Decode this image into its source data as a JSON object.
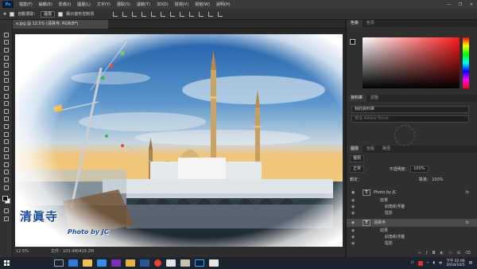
{
  "menubar": {
    "app_logo": "Ps",
    "items": [
      "檔案(F)",
      "編輯(E)",
      "影像(I)",
      "圖層(L)",
      "文字(Y)",
      "選取(S)",
      "濾鏡(T)",
      "3D(D)",
      "檢視(V)",
      "視窗(W)",
      "說明(H)"
    ],
    "minimize": "—",
    "maximize": "❐",
    "close": "✕"
  },
  "options": {
    "auto_select_label": "自動選取：",
    "auto_select_value": "圖層",
    "transform_label": "顯示變形控制項"
  },
  "document": {
    "tab_title": "a.jpg @ 12.5% (清眞寺, RGB/8*)",
    "zoom": "12.5%",
    "file_info": "文件：103.4M/419.2M",
    "canvas_text_title": "清眞寺",
    "canvas_text_credit": "Photo by JC"
  },
  "panels": {
    "color_tabs": [
      "色板",
      "色票"
    ],
    "library_tabs": [
      "資料庫",
      "調整"
    ],
    "library_dropdown": "我的資料庫",
    "library_search": "搜尋 Adobe Stock",
    "layers_tabs": [
      "圖層",
      "色版",
      "路徑"
    ],
    "filter_label": "種類",
    "blend_mode": "正常",
    "opacity_label": "不透明度：",
    "opacity_value": "100%",
    "lock_label": "鎖定：",
    "fill_label": "填滿：",
    "fill_value": "100%"
  },
  "layers": [
    {
      "name": "Photo by JC",
      "selected": false,
      "effects_label": "效果",
      "effects": [
        "斜角和浮雕",
        "陰影"
      ]
    },
    {
      "name": "清眞寺",
      "selected": true,
      "effects_label": "效果",
      "effects": [
        "斜角和浮雕",
        "陰影"
      ]
    }
  ],
  "taskbar": {
    "input_method": "中",
    "clock_time": "下午 02:06",
    "clock_date": "2018/10/5"
  },
  "colors": {
    "menubar_bg": "#3a3a3a",
    "panel_bg": "#2f2f2f",
    "taskbar_bg": "#1c2430",
    "ps_blue": "#31a8ff"
  }
}
